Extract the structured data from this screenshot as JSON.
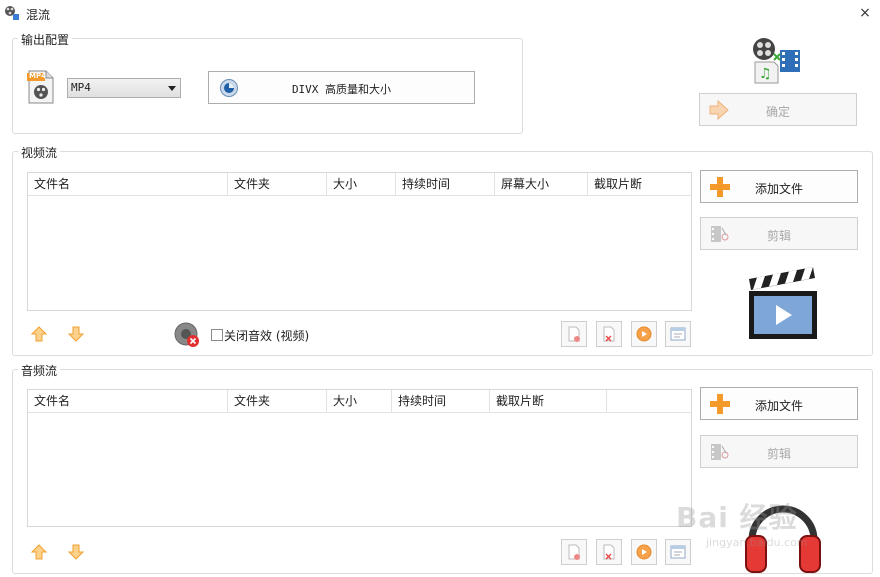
{
  "window": {
    "title": "混流",
    "close_glyph": "×"
  },
  "output": {
    "group_label": "输出配置",
    "format_value": "MP4",
    "format_icon_label": "MP4",
    "quality_button": "DIVX 高质量和大小",
    "confirm_button": "确定"
  },
  "video": {
    "group_label": "视频流",
    "columns": [
      "文件名",
      "文件夹",
      "大小",
      "持续时间",
      "屏幕大小",
      "截取片断"
    ],
    "add_button": "添加文件",
    "edit_button": "剪辑",
    "mute_label": "关闭音效 (视频)"
  },
  "audio": {
    "group_label": "音频流",
    "columns": [
      "文件名",
      "文件夹",
      "大小",
      "持续时间",
      "截取片断",
      ""
    ],
    "add_button": "添加文件",
    "edit_button": "剪辑"
  },
  "watermark": {
    "text": "Bai 经验",
    "sub": "jingyan.baidu.com"
  },
  "colors": {
    "accent_orange": "#f39a2b",
    "border": "#dcdcdc",
    "headphone_red": "#e53935"
  }
}
